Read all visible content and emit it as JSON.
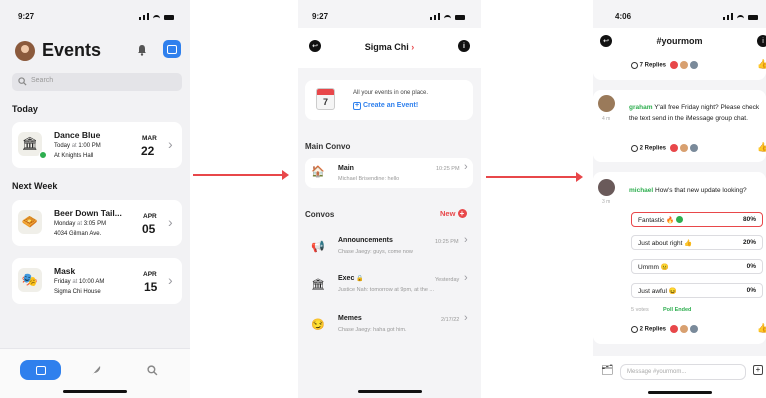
{
  "screen1": {
    "time": "9:27",
    "title": "Events",
    "search_placeholder": "Search",
    "section_today": "Today",
    "section_next_week": "Next Week",
    "events": [
      {
        "name": "Dance Blue",
        "day": "Today",
        "at": "at",
        "time": "1:00 PM",
        "location": "At Knights Hall",
        "month": "MAR",
        "date": "22",
        "icon": "🏛"
      },
      {
        "name": "Beer Down Tail...",
        "day": "Monday",
        "at": "at",
        "time": "3:05 PM",
        "location": "4034 Gilman Ave.",
        "month": "APR",
        "date": "05",
        "icon": "🧇"
      },
      {
        "name": "Mask",
        "day": "Friday",
        "at": "at",
        "time": "10:00 AM",
        "location": "Sigma Chi House",
        "month": "APR",
        "date": "15",
        "icon": "🎭"
      }
    ]
  },
  "screen2": {
    "time": "9:27",
    "title": "Sigma Chi",
    "promo_text": "All your events in one place.",
    "promo_link": "Create an Event!",
    "calendar_day": "7",
    "section_main": "Main Convo",
    "main_convo": {
      "name": "Main",
      "time": "10:25 PM",
      "preview": "Michael Brisendine: hello"
    },
    "section_convos": "Convos",
    "new_label": "New",
    "convos": [
      {
        "name": "Announcements",
        "time": "10:25 PM",
        "preview": "Chase Jaegy: guys, come now"
      },
      {
        "name": "Exec",
        "time": "Yesterday",
        "preview": "Justice Nah: tomorrow at 9pm, at the ..."
      },
      {
        "name": "Memes",
        "time": "2/17/22",
        "preview": "Chase Jaegy: haha got him."
      }
    ]
  },
  "screen3": {
    "time": "4:06",
    "title": "#yourmom",
    "replies_top": "7 Replies",
    "msg1": {
      "author": "graham",
      "text": "Y'all free Friday night? Please check the text send in the iMessage group chat.",
      "time": "4 m",
      "replies": "2 Replies"
    },
    "msg2": {
      "author": "michael",
      "text": "How's that new update looking?",
      "time": "3 m"
    },
    "poll": [
      {
        "label": "Fantastic 🔥",
        "pct": "80%"
      },
      {
        "label": "Just about right 👍",
        "pct": "20%"
      },
      {
        "label": "Ummm 😐",
        "pct": "0%"
      },
      {
        "label": "Just awful 😖",
        "pct": "0%"
      }
    ],
    "votes": "5 votes",
    "poll_status": "Poll Ended",
    "replies_bottom": "2 Replies",
    "message_placeholder": "Message #yourmom..."
  }
}
